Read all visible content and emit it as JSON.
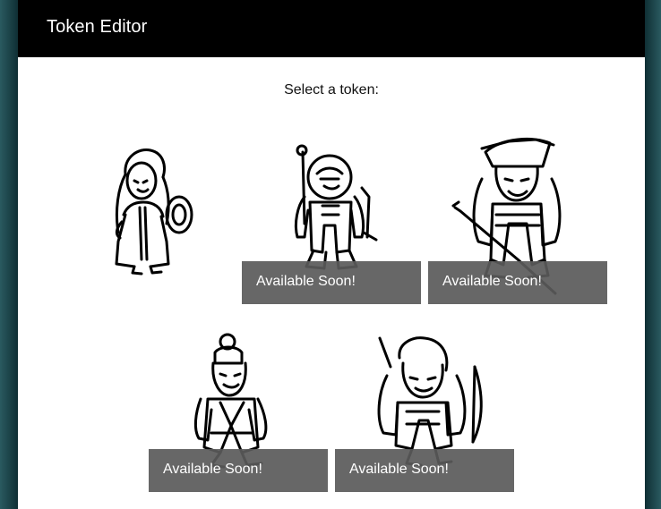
{
  "header": {
    "title": "Token Editor"
  },
  "prompt": "Select a token:",
  "tokens": [
    {
      "icon": "elf-shieldbearer-icon",
      "available": true,
      "overlay": ""
    },
    {
      "icon": "armored-dwarf-icon",
      "available": false,
      "overlay": "Available Soon!"
    },
    {
      "icon": "pirate-captain-icon",
      "available": false,
      "overlay": "Available Soon!"
    },
    {
      "icon": "monk-icon",
      "available": false,
      "overlay": "Available Soon!"
    },
    {
      "icon": "archer-icon",
      "available": false,
      "overlay": "Available Soon!"
    }
  ]
}
